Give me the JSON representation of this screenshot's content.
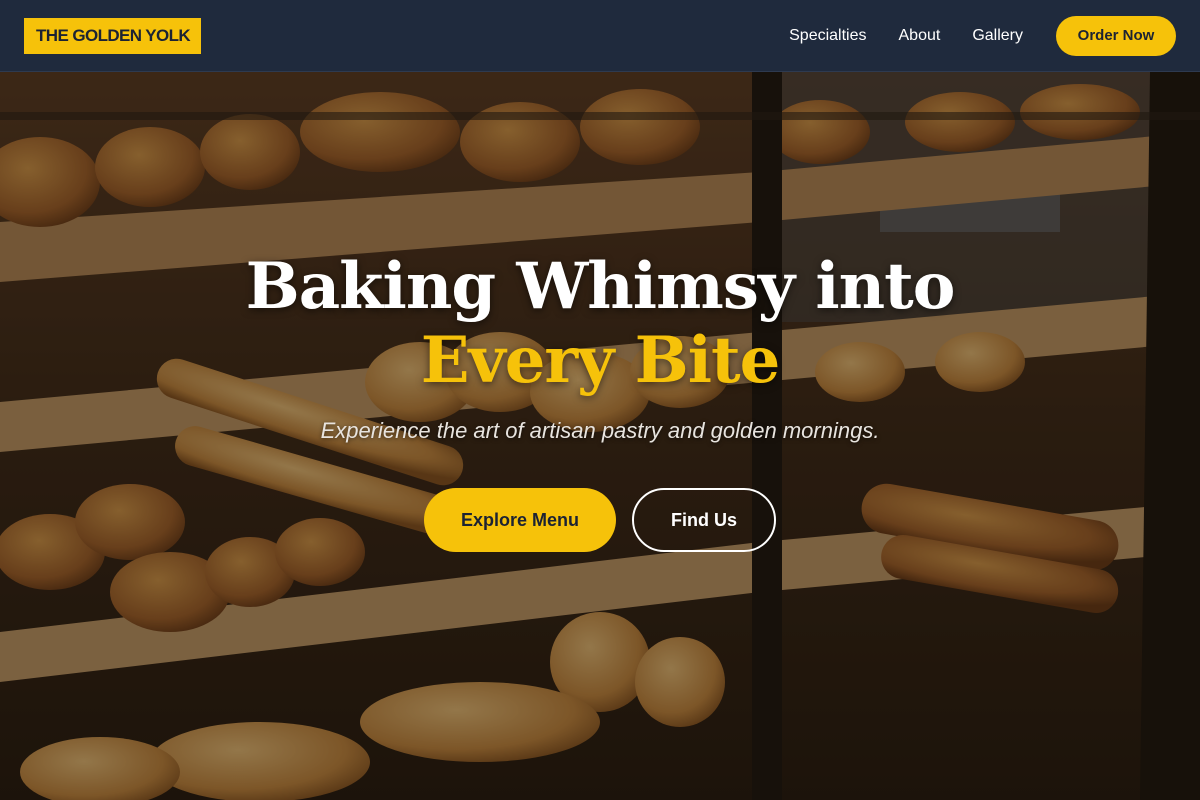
{
  "header": {
    "logo": "THE GOLDEN YOLK",
    "nav": [
      "Specialties",
      "About",
      "Gallery"
    ],
    "cta": "Order Now"
  },
  "hero": {
    "headline_main": "Baking Whimsy into ",
    "headline_accent": "Every Bite",
    "subtitle": "Experience the art of artisan pastry and golden mornings.",
    "primary_cta": "Explore Menu",
    "secondary_cta": "Find Us"
  },
  "colors": {
    "accent": "#f6c20a",
    "header_bg": "#1f2a3d",
    "text_light": "#ffffff"
  }
}
